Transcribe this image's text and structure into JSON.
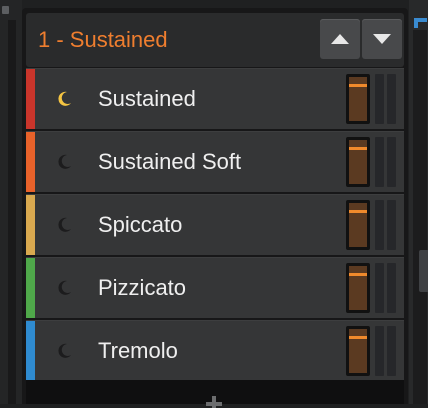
{
  "header": {
    "title": "1 - Sustained",
    "title_color": "#ef7e2f",
    "up_icon": "triangle-up-icon",
    "down_icon": "triangle-down-icon"
  },
  "articulations": [
    {
      "label": "Sustained",
      "color": "#c9352b",
      "active": true,
      "icon": "moon-icon",
      "level": 0.85
    },
    {
      "label": "Sustained Soft",
      "color": "#e8622a",
      "active": false,
      "icon": "moon-icon",
      "level": 0.85
    },
    {
      "label": "Spiccato",
      "color": "#d9a94f",
      "active": false,
      "icon": "moon-icon",
      "level": 0.85
    },
    {
      "label": "Pizzicato",
      "color": "#4fa84a",
      "active": false,
      "icon": "moon-icon",
      "level": 0.85
    },
    {
      "label": "Tremolo",
      "color": "#2f8bd0",
      "active": false,
      "icon": "moon-icon",
      "level": 0.85
    }
  ],
  "colors": {
    "moon_active": "#f5c542",
    "moon_inactive": "#1c1c1d",
    "meter_level": "#f08a2c",
    "meter_fill": "#5b3a21"
  },
  "add_icon": "plus-icon"
}
